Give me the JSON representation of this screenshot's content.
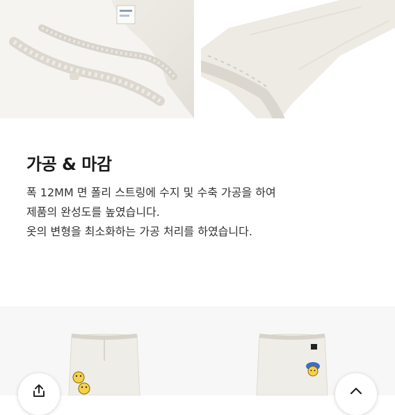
{
  "section": {
    "title": "가공 & 마감",
    "lines": [
      "폭 12MM 면 폴리 스트링에 수지 및 수축 가공을 하여",
      "제품의 완성도를 높였습니다.",
      "옷의 변형을 최소화하는 가공 처리를 하였습니다."
    ]
  },
  "photos": [
    {
      "subject": "white garment with elastic shirred waistband and label"
    },
    {
      "subject": "white quilted fabric edge close-up"
    }
  ],
  "products": [
    {
      "subject": "white jogger pants with smiley patches"
    },
    {
      "subject": "white jogger pants with logo and bucket-hat patch"
    }
  ],
  "buttons": {
    "share_icon": "share-icon",
    "top_icon": "chevron-up-icon"
  },
  "colors": {
    "background": "#ffffff",
    "text": "#222222",
    "garment": "#f0eee9"
  }
}
